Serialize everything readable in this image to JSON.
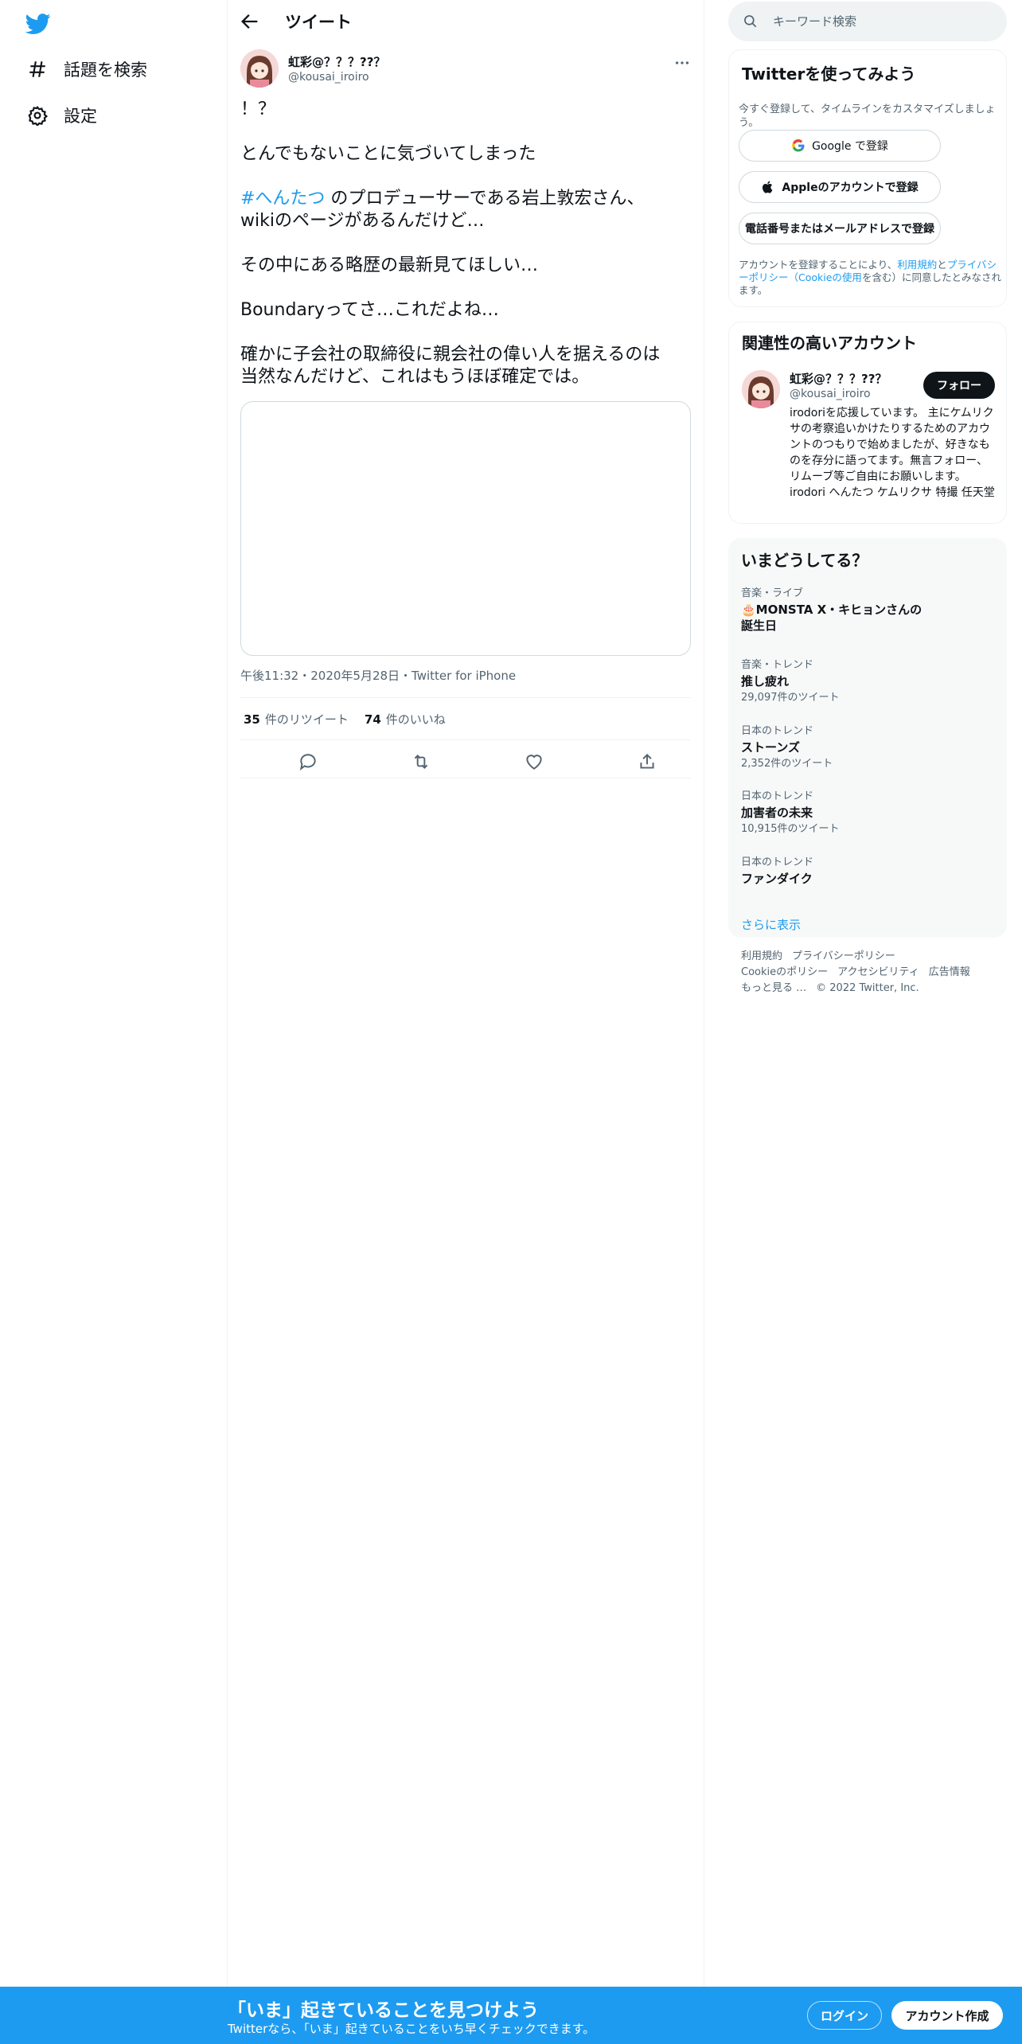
{
  "nav": {
    "items": [
      {
        "label": "話題を検索",
        "icon": "hashtag-icon"
      },
      {
        "label": "設定",
        "icon": "gear-icon"
      }
    ]
  },
  "header": {
    "title": "ツイート"
  },
  "tweet": {
    "author_name": "虹彩@？？？??？",
    "author_handle": "@kousai_iroiro",
    "text": {
      "line1": "！？",
      "line2": "とんでもないことに気づいてしまった",
      "hashtag": "#へんたつ",
      "line3_rest": " のプロデューサーである岩上敦宏さん、",
      "line4": "wikiのページがあるんだけど…",
      "line5": "その中にある略歴の最新見てほしい…",
      "line6": "Boundaryってさ…これだよね…",
      "line7": "確かに子会社の取締役に親会社の偉い人を据えるのは",
      "line8": "当然なんだけど、これはもうほぼ確定では。"
    },
    "timestamp": "午後11:32・2020年5月28日・Twitter for iPhone",
    "retweets": "35",
    "retweets_label": "件のリツイート",
    "likes": "74",
    "likes_label": "件のいいね"
  },
  "search": {
    "placeholder": "キーワード検索"
  },
  "signup_card": {
    "title": "Twitterを使ってみよう",
    "subtitle": "今すぐ登録して、タイムラインをカスタマイズしましょう。",
    "google_label": "Google で登録",
    "apple_label": "Appleのアカウントで登録",
    "phone_label": "電話番号またはメールアドレスで登録",
    "legal_prefix": "アカウントを登録することにより、",
    "legal_terms": "利用規約",
    "legal_and": "と",
    "legal_privacy": "プライバシーポリシー（Cookieの使用",
    "legal_suffix": "を含む）に同意したとみなされます。"
  },
  "related": {
    "title": "関連性の高いアカウント",
    "name": "虹彩@？？？??？",
    "handle": "@kousai_iroiro",
    "follow_label": "フォロー",
    "bio": "irodoriを応援しています。 主にケムリクサの考察追いかけたりするためのアカウントのつもりで始めましたが、好きなものを存分に語ってます。無言フォロー、リムーブ等ご自由にお願いします。irodori へんたつ ケムリクサ 特撮 任天堂"
  },
  "trends": {
    "title": "いまどうしてる？",
    "items": [
      {
        "category": "音楽・ライブ",
        "name": "🎂MONSTA X・キヒョンさんの誕生日",
        "count": ""
      },
      {
        "category": "音楽・トレンド",
        "name": "推し疲れ",
        "count": "29,097件のツイート"
      },
      {
        "category": "日本のトレンド",
        "name": "ストーンズ",
        "count": "2,352件のツイート"
      },
      {
        "category": "日本のトレンド",
        "name": "加害者の未来",
        "count": "10,915件のツイート"
      },
      {
        "category": "日本のトレンド",
        "name": "ファンダイク",
        "count": ""
      }
    ],
    "show_more": "さらに表示"
  },
  "footer": {
    "links": [
      "利用規約",
      "プライバシーポリシー",
      "Cookieのポリシー",
      "アクセシビリティ",
      "広告情報",
      "もっと見る …"
    ],
    "copyright": "© 2022 Twitter, Inc."
  },
  "banner": {
    "title": "「いま」起きていることを見つけよう",
    "subtitle": "Twitterなら、「いま」起きていることをいち早くチェックできます。",
    "login_label": "ログイン",
    "signup_label": "アカウント作成"
  },
  "colors": {
    "accent": "#1d9bf0",
    "text": "#0f1419",
    "secondary": "#536471"
  }
}
